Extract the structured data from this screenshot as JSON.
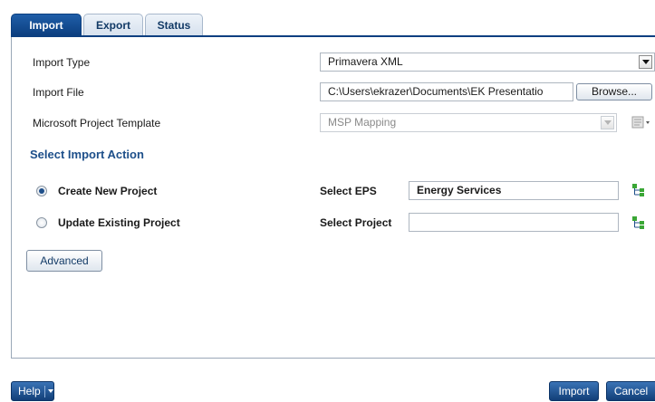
{
  "tabs": [
    {
      "label": "Import",
      "active": true
    },
    {
      "label": "Export",
      "active": false
    },
    {
      "label": "Status",
      "active": false
    }
  ],
  "form": {
    "import_type": {
      "label": "Import Type",
      "value": "Primavera XML"
    },
    "import_file": {
      "label": "Import File",
      "value": "C:\\Users\\ekrazer\\Documents\\EK Presentatio",
      "browse_label": "Browse..."
    },
    "template": {
      "label": "Microsoft Project Template",
      "value": "MSP Mapping"
    }
  },
  "action": {
    "section_title": "Select Import Action",
    "create_new": {
      "label": "Create New Project",
      "checked": true
    },
    "update_existing": {
      "label": "Update Existing Project",
      "checked": false
    },
    "select_eps": {
      "label": "Select EPS",
      "value": "Energy Services"
    },
    "select_project": {
      "label": "Select Project",
      "value": ""
    },
    "advanced_label": "Advanced"
  },
  "footer": {
    "help_label": "Help",
    "import_label": "Import",
    "cancel_label": "Cancel"
  },
  "colors": {
    "accent": "#0c3f80",
    "section_title": "#1d4f8a",
    "tree_icon_green": "#3aa635"
  },
  "icons": [
    "dropdown-arrow-icon",
    "template-settings-icon",
    "tree-select-icon",
    "help-menu-arrow-icon"
  ]
}
